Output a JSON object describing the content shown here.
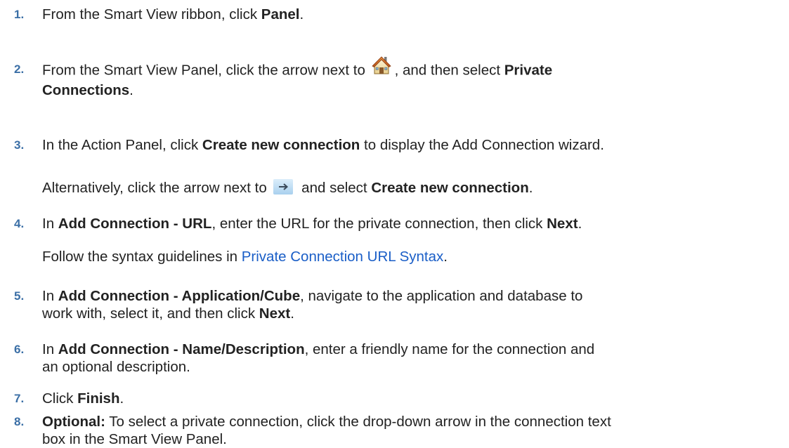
{
  "steps": [
    {
      "number": "1.",
      "pre": "From the Smart View ribbon, click ",
      "bold": "Panel",
      "post": "."
    },
    {
      "number": "2.",
      "pre": "From the Smart View Panel, click the arrow next to ",
      "mid": ", and then select ",
      "bold_line1": "Private",
      "bold_line2": "Connections",
      "post": "."
    },
    {
      "number": "3.",
      "pre": "In the Action Panel, click ",
      "bold": "Create new connection",
      "post": " to display the Add Connection wizard.",
      "alt_pre": "Alternatively, click the arrow next to ",
      "alt_mid": " and select ",
      "alt_bold": "Create new connection",
      "alt_post": "."
    },
    {
      "number": "4.",
      "pre": "In ",
      "bold": "Add Connection - URL",
      "mid": ", enter the URL for the private connection, then click ",
      "bold2": "Next",
      "post": ".",
      "follow_pre": "Follow the syntax guidelines in ",
      "follow_link": "Private Connection URL Syntax",
      "follow_post": "."
    },
    {
      "number": "5.",
      "pre": "In ",
      "bold": "Add Connection - Application/Cube",
      "mid": ", navigate to the application and database to",
      "line2_pre": "work with, select it, and then click ",
      "bold2": "Next",
      "post": "."
    },
    {
      "number": "6.",
      "pre": "In ",
      "bold": "Add Connection - Name/Description",
      "mid": ", enter a friendly name for the connection and",
      "line2": "an optional description."
    },
    {
      "number": "7.",
      "pre": "Click ",
      "bold": "Finish",
      "post": "."
    },
    {
      "number": "8.",
      "bold": "Optional:",
      "mid": " To select a private connection, click the drop-down arrow in the connection text",
      "line2": "box in the Smart View Panel."
    }
  ],
  "icons": {
    "home": "home-icon",
    "arrow": "arrow-right-icon"
  },
  "colors": {
    "step_number": "#3b6fa6",
    "link": "#1a5ec7",
    "text": "#222222"
  }
}
